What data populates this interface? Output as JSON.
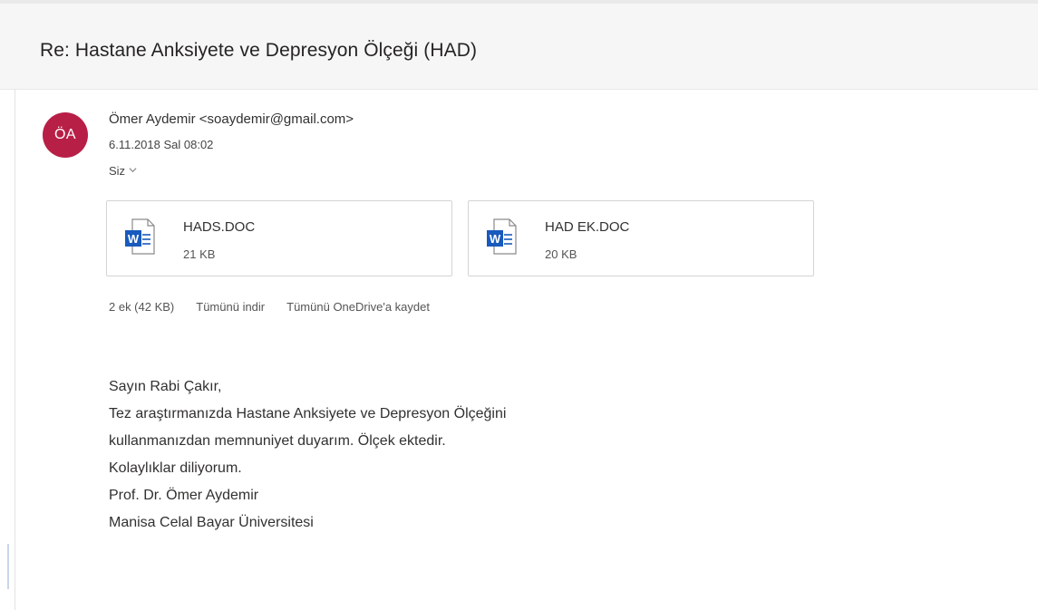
{
  "email": {
    "subject": "Re: Hastane Anksiyete ve Depresyon Ölçeği (HAD)",
    "sender": {
      "initials": "ÖA",
      "display": "Ömer Aydemir <soaydemir@gmail.com>",
      "avatar_color": "#b81f46"
    },
    "date": "6.11.2018 Sal 08:02",
    "recipient": "Siz",
    "recipient_icon": "chevron-down-icon",
    "attachments": [
      {
        "name": "HADS.DOC",
        "size": "21 KB",
        "icon": "word-doc-icon"
      },
      {
        "name": "HAD EK.DOC",
        "size": "20 KB",
        "icon": "word-doc-icon"
      }
    ],
    "attachment_actions": {
      "summary": "2 ek (42 KB)",
      "download_all": "Tümünü indir",
      "save_onedrive": "Tümünü OneDrive'a kaydet"
    },
    "body_lines": [
      "Sayın Rabi Çakır,",
      "Tez araştırmanızda Hastane Anksiyete ve Depresyon Ölçeğini",
      "kullanmanızdan memnuniyet duyarım. Ölçek ektedir.",
      "Kolaylıklar diliyorum.",
      "Prof. Dr. Ömer Aydemir",
      "Manisa Celal Bayar Üniversitesi"
    ]
  },
  "colors": {
    "word_blue": "#185abd",
    "header_bg": "#f6f6f6"
  }
}
